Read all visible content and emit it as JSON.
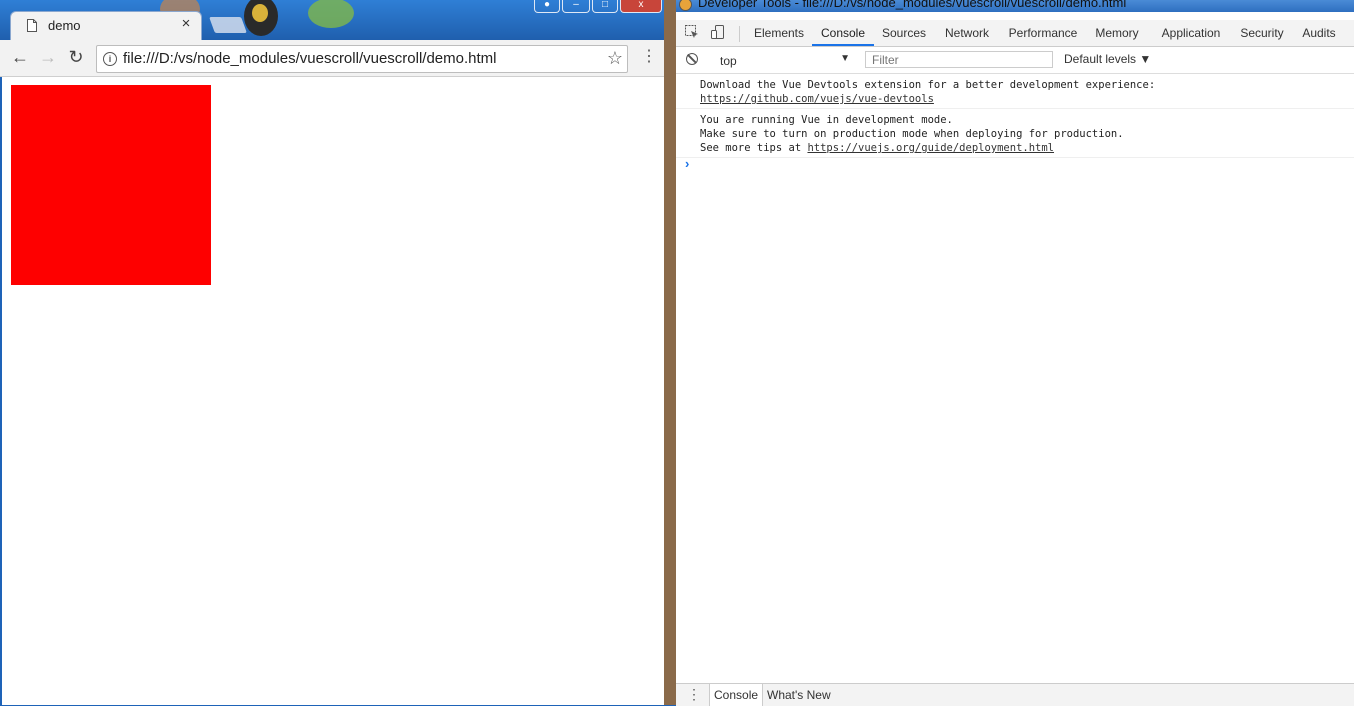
{
  "browser": {
    "tab_title": "demo",
    "tab_close": "×",
    "url": "file:///D:/vs/node_modules/vuescroll/vuescroll/demo.html",
    "page": {
      "box_color": "#fe0000"
    }
  },
  "devtools": {
    "window_title": "Developer Tools - file:///D:/vs/node_modules/vuescroll/vuescroll/demo.html",
    "tabs": [
      "Elements",
      "Console",
      "Sources",
      "Network",
      "Performance",
      "Memory",
      "Application",
      "Security",
      "Audits"
    ],
    "active_tab": "Console",
    "context": "top",
    "filter_placeholder": "Filter",
    "levels": "Default levels ▼",
    "messages": [
      {
        "line1": "Download the Vue Devtools extension for a better development experience:",
        "link": "https://github.com/vuejs/vue-devtools"
      },
      {
        "line1": "You are running Vue in development mode.",
        "line2": "Make sure to turn on production mode when deploying for production.",
        "line3_prefix": "See more tips at ",
        "link": "https://vuejs.org/guide/deployment.html"
      }
    ],
    "drawer_tabs": [
      "Console",
      "What's New"
    ]
  },
  "colors": {
    "accent": "#1a73e8",
    "titlebar": "#2f7fd6"
  }
}
